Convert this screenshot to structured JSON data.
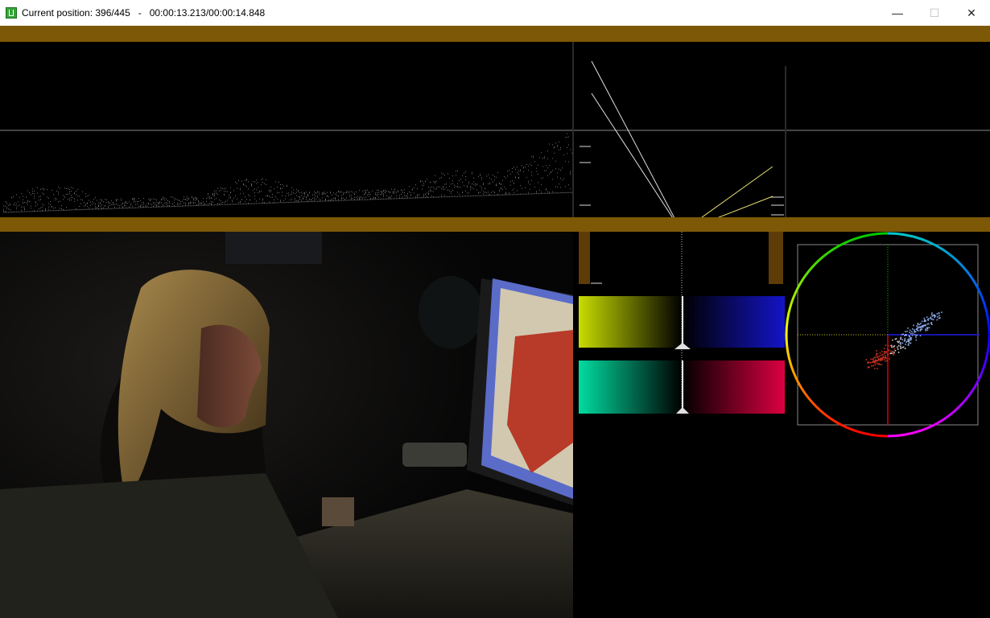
{
  "window": {
    "title": "Current position: 396/445   -   00:00:13.213/00:00:14.848",
    "controls": {
      "minimize": "—",
      "maximize": "☐",
      "close": "✕"
    }
  },
  "colors": {
    "band": "#7d5806",
    "yellow_bar": "#c8dc00",
    "blue_bar": "#1414c8",
    "cyan_bar": "#00dca0",
    "red_bar": "#dc0040"
  }
}
